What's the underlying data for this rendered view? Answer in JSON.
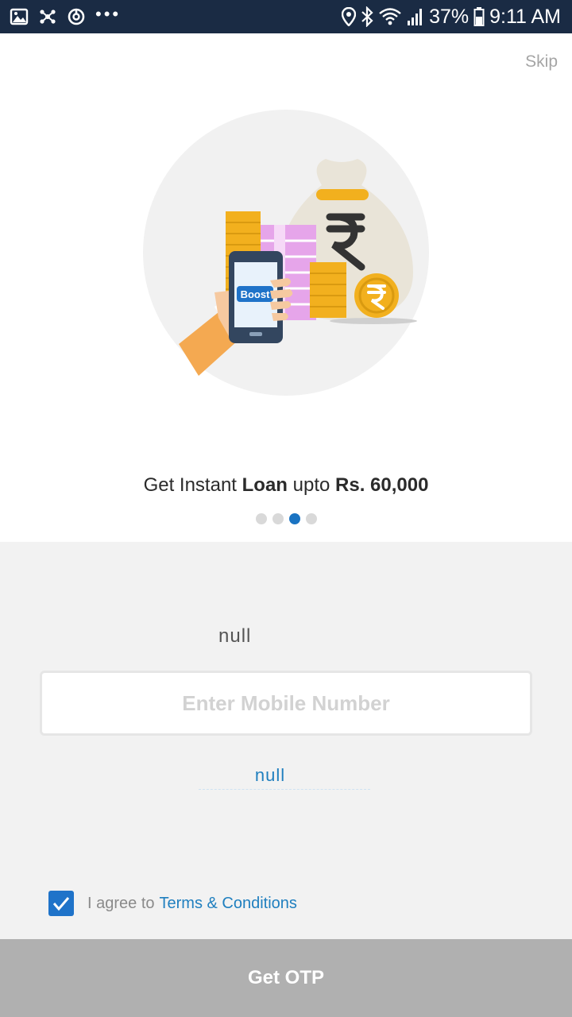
{
  "status_bar": {
    "battery": "37%",
    "time": "9:11 AM",
    "left_icons": [
      "gallery-icon",
      "network-icon",
      "sync-icon",
      "more-notifications-icon"
    ],
    "right_icons": [
      "location-icon",
      "bluetooth-icon",
      "wifi-icon",
      "signal-icon",
      "battery-icon"
    ]
  },
  "onboarding": {
    "skip_label": "Skip",
    "illustration": {
      "phone_brand_text": "Boost",
      "icon": "loan-money-illustration"
    },
    "headline": {
      "part1": "Get Instant ",
      "bold1": "Loan",
      "part2": " upto ",
      "bold2": "Rs. 60,000"
    },
    "pager": {
      "total": 4,
      "active_index": 2
    }
  },
  "form": {
    "prompt": "null",
    "mobile_input": {
      "value": "",
      "placeholder": "Enter Mobile Number"
    },
    "link_text": "null",
    "agree": {
      "checked": true,
      "text": "I agree to",
      "link": "Terms & Conditions"
    },
    "submit_label": "Get OTP"
  },
  "colors": {
    "status_bar": "#1a2b44",
    "accent": "#1a73c2",
    "form_background": "#f2f2f2",
    "button_disabled": "#b0b0b0"
  }
}
